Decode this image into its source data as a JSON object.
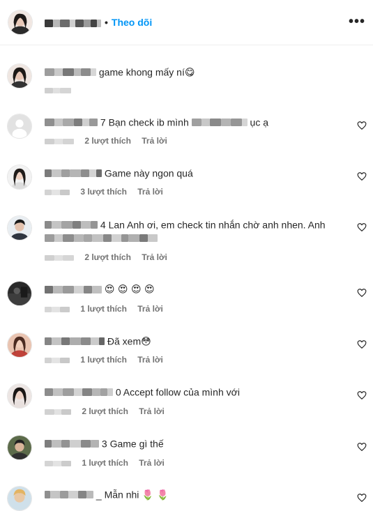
{
  "header": {
    "follow_label": "Theo dõi",
    "separator": "•",
    "more_label": "•••"
  },
  "comments": [
    {
      "text": "game khong mấy ní😋",
      "likes": "",
      "reply": "",
      "has_heart": false
    },
    {
      "text": "7 Bạn check ib mình",
      "text_after": "ục ạ",
      "likes": "2 lượt thích",
      "reply": "Trả lời",
      "has_heart": true
    },
    {
      "text": "Game này ngon quá",
      "likes": "3 lượt thích",
      "reply": "Trả lời",
      "has_heart": true
    },
    {
      "text": "4 Lan Anh ơi, em check tin nhắn chờ anh nhen. Anh",
      "likes": "2 lượt thích",
      "reply": "Trả lời",
      "has_heart": true
    },
    {
      "text": "😍 😍 😍 😍",
      "likes": "1 lượt thích",
      "reply": "Trả lời",
      "has_heart": true
    },
    {
      "text": "Đã xem😳",
      "likes": "1 lượt thích",
      "reply": "Trả lời",
      "has_heart": true
    },
    {
      "text": "0 Accept follow của mình với",
      "likes": "2 lượt thích",
      "reply": "Trả lời",
      "has_heart": true
    },
    {
      "text": "3 Game gì thế",
      "likes": "1 lượt thích",
      "reply": "Trả lời",
      "has_heart": true
    },
    {
      "text": "_ Mẫn nhi 🌷 🌷",
      "likes": "",
      "reply": "",
      "has_heart": true
    }
  ]
}
